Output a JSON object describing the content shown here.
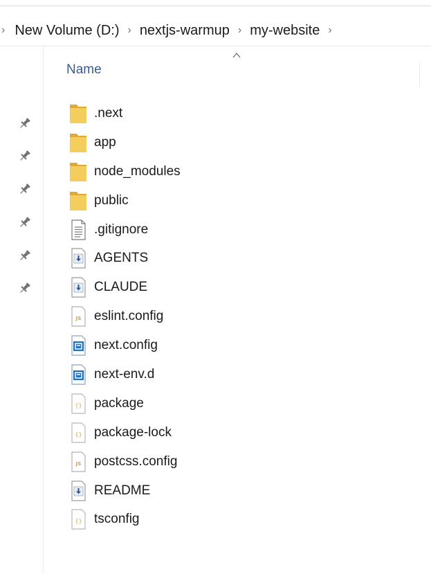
{
  "breadcrumb": {
    "items": [
      "New Volume (D:)",
      "nextjs-warmup",
      "my-website"
    ]
  },
  "column_header": {
    "name": "Name"
  },
  "pinned_count": 6,
  "files": [
    {
      "name": ".next",
      "icon": "folder-icon"
    },
    {
      "name": "app",
      "icon": "folder-icon"
    },
    {
      "name": "node_modules",
      "icon": "folder-icon"
    },
    {
      "name": "public",
      "icon": "folder-icon"
    },
    {
      "name": ".gitignore",
      "icon": "text-file-icon"
    },
    {
      "name": "AGENTS",
      "icon": "markdown-file-icon"
    },
    {
      "name": "CLAUDE",
      "icon": "markdown-file-icon"
    },
    {
      "name": "eslint.config",
      "icon": "js-file-icon"
    },
    {
      "name": "next.config",
      "icon": "ts-file-icon"
    },
    {
      "name": "next-env.d",
      "icon": "ts-file-icon"
    },
    {
      "name": "package",
      "icon": "json-file-icon"
    },
    {
      "name": "package-lock",
      "icon": "json-file-icon"
    },
    {
      "name": "postcss.config",
      "icon": "js-file-icon"
    },
    {
      "name": "README",
      "icon": "markdown-file-icon"
    },
    {
      "name": "tsconfig",
      "icon": "json-file-icon"
    }
  ],
  "colors": {
    "folder": "#f5cd5c",
    "folder_dark": "#e0aa32",
    "js_badge": "#c9a43a",
    "ts_badge": "#1f6fc2",
    "header_text": "#3c5a8a"
  }
}
